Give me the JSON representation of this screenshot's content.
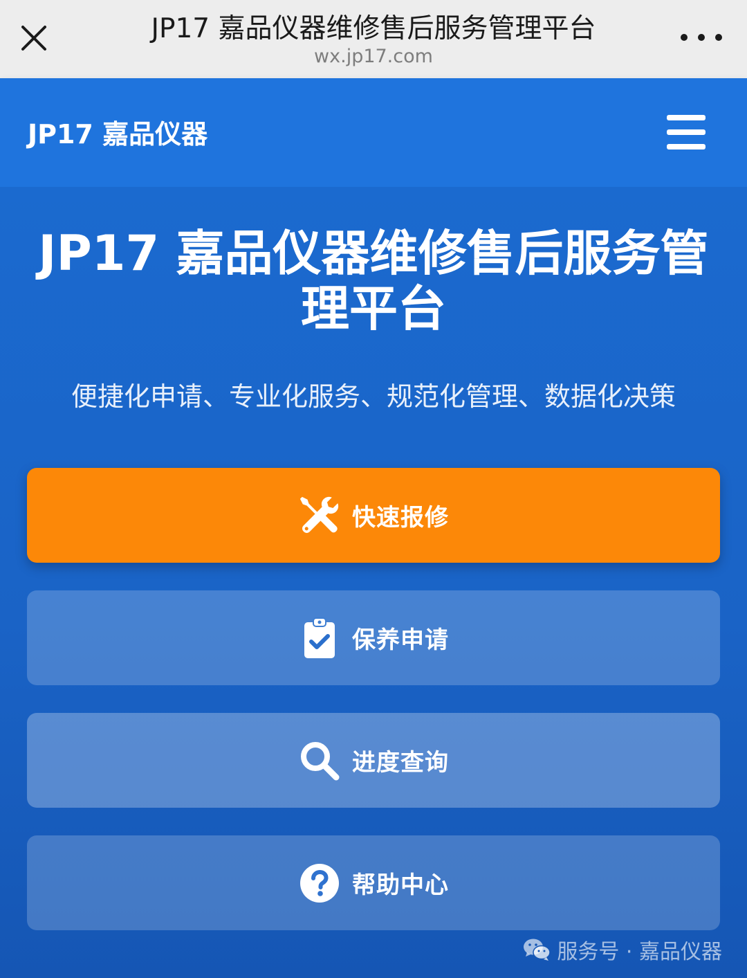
{
  "browser": {
    "title": "JP17 嘉品仪器维修售后服务管理平台",
    "url": "wx.jp17.com"
  },
  "header": {
    "brand": "JP17 嘉品仪器"
  },
  "hero": {
    "title": "JP17 嘉品仪器维修售后服务管理平台",
    "subtitle": "便捷化申请、专业化服务、规范化管理、数据化决策"
  },
  "actions": [
    {
      "label": "快速报修",
      "icon": "tools-icon"
    },
    {
      "label": "保养申请",
      "icon": "clipboard-check-icon"
    },
    {
      "label": "进度查询",
      "icon": "search-icon"
    },
    {
      "label": "帮助中心",
      "icon": "question-circle-icon"
    }
  ],
  "watermark": {
    "text": "服务号 · 嘉品仪器"
  },
  "colors": {
    "primary_blue": "#1a62c6",
    "header_blue": "#1f74dd",
    "accent_orange": "#fc8808",
    "browser_bar": "#ededed"
  }
}
